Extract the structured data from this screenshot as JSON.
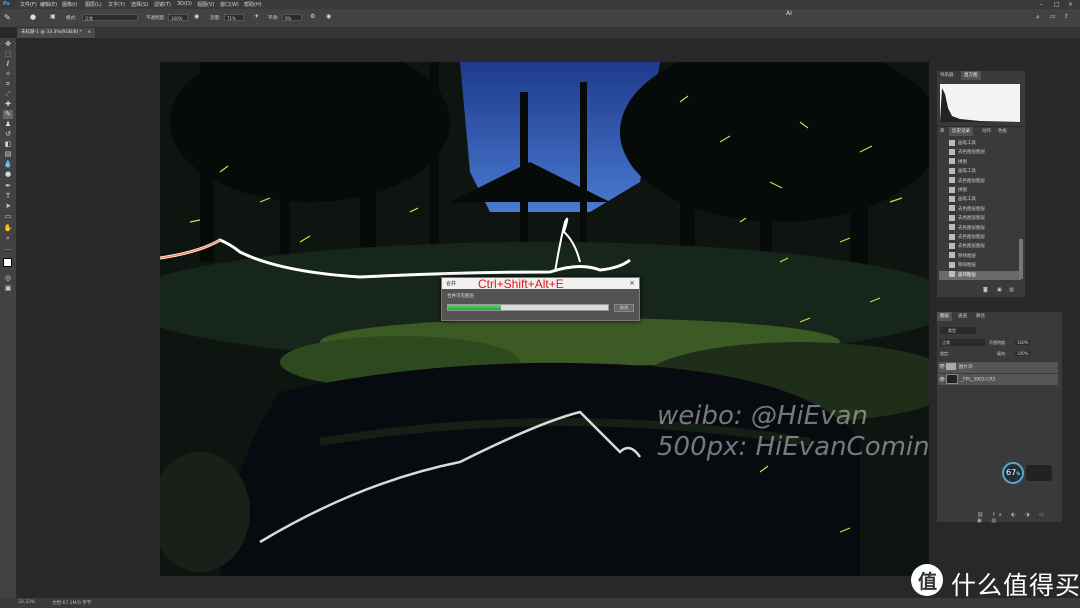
{
  "menubar": {
    "logo": "Ps",
    "items": [
      "文件(F)",
      "编辑(E)",
      "图像(I)",
      "图层(L)",
      "文字(Y)",
      "选择(S)",
      "滤镜(T)",
      "3D(D)",
      "视图(V)",
      "窗口(W)",
      "帮助(H)"
    ],
    "right_panel_label": "AI"
  },
  "options": {
    "mode_label": "模式:",
    "mode_value": "正常",
    "opacity_label": "不透明度:",
    "opacity_value": "100%",
    "flow_label": "流量:",
    "flow_value": "71%",
    "smooth_label": "平滑:",
    "smooth_value": "0%"
  },
  "document": {
    "tab_title": "未标题-1 @ 33.3%(RGB/8) *",
    "close": "×"
  },
  "dialog": {
    "title": "合并",
    "shortcut": "Ctrl+Shift+Alt+E",
    "message": "合并可见图层",
    "progress": 0.33,
    "cancel_label": "取消",
    "close": "×"
  },
  "photo_credits": {
    "line1": "weibo:  @HiEvan",
    "line2": "500px:  HiEvanComing"
  },
  "histogram_panel": {
    "tabs": [
      "导航器",
      "直方图"
    ]
  },
  "history_panel": {
    "tabs": [
      "库",
      "历史记录",
      "动作",
      "色板"
    ],
    "items": [
      "画笔工具",
      "去色图层图层",
      "拼图",
      "画笔工具",
      "去色图层图层",
      "拼图",
      "画笔工具",
      "去色图层图层",
      "去色图层图层",
      "去色图层图层",
      "去色图层图层",
      "去色图层图层",
      "移除图层",
      "移除图层",
      "盖印图层"
    ]
  },
  "layers_panel": {
    "tabs": [
      "图层",
      "通道",
      "路径"
    ],
    "kind_label": "类型",
    "blend_mode": "正常",
    "opacity_label": "不透明度:",
    "opacity_value": "100%",
    "lock_label": "锁定:",
    "fill_label": "填充:",
    "fill_value": "100%",
    "layers": [
      {
        "name": "图片浏",
        "type": "group"
      },
      {
        "name": "_FPL_3903.CR2",
        "type": "image"
      }
    ]
  },
  "speed_widget": {
    "value": "67",
    "unit": "%"
  },
  "status": {
    "zoom": "33.33%",
    "doc": "文档:67.1M/0 字节"
  },
  "watermark": {
    "text": "什么值得买",
    "logo": "值"
  },
  "colors": {
    "accent_red": "#e01818",
    "progress_green": "#2fbf48"
  }
}
